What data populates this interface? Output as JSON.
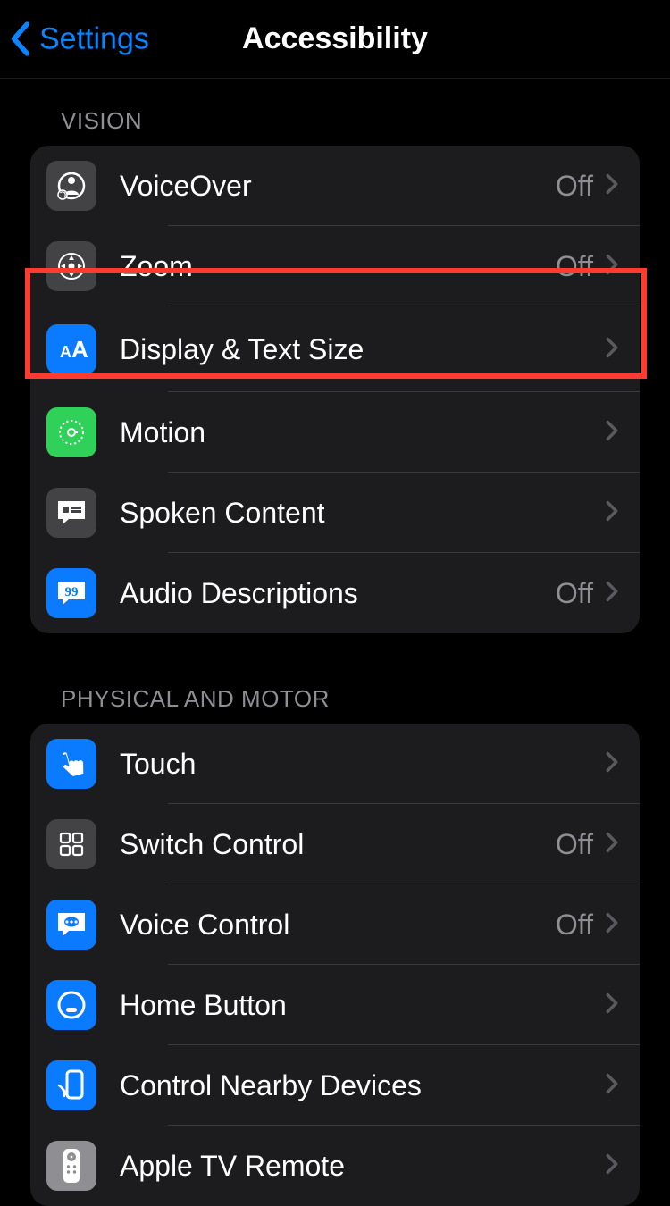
{
  "header": {
    "back_label": "Settings",
    "title": "Accessibility"
  },
  "sections": {
    "vision": {
      "header": "VISION",
      "items": [
        {
          "label": "VoiceOver",
          "value": "Off"
        },
        {
          "label": "Zoom",
          "value": "Off"
        },
        {
          "label": "Display & Text Size",
          "value": ""
        },
        {
          "label": "Motion",
          "value": ""
        },
        {
          "label": "Spoken Content",
          "value": ""
        },
        {
          "label": "Audio Descriptions",
          "value": "Off"
        }
      ]
    },
    "physical": {
      "header": "PHYSICAL AND MOTOR",
      "items": [
        {
          "label": "Touch",
          "value": ""
        },
        {
          "label": "Switch Control",
          "value": "Off"
        },
        {
          "label": "Voice Control",
          "value": "Off"
        },
        {
          "label": "Home Button",
          "value": ""
        },
        {
          "label": "Control Nearby Devices",
          "value": ""
        },
        {
          "label": "Apple TV Remote",
          "value": ""
        }
      ]
    }
  }
}
